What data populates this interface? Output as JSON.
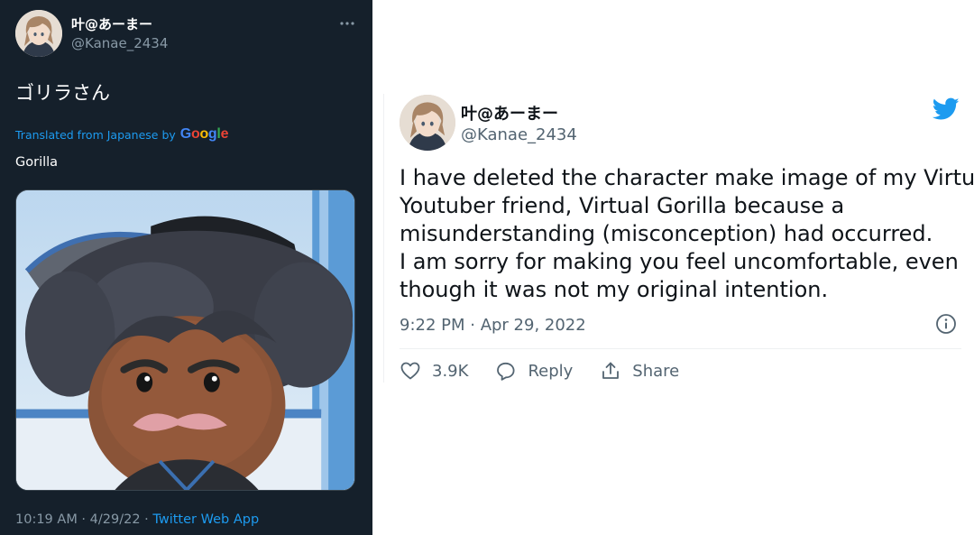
{
  "dark_tweet": {
    "display_name": "叶@あーまー",
    "handle": "@Kanae_2434",
    "more_icon": "more-horizontal-icon",
    "text": "ゴリラさん",
    "translated_label": "Translated from Japanese by",
    "google_letters": [
      "G",
      "o",
      "o",
      "g",
      "l",
      "e"
    ],
    "google_colors": [
      "#4285f4",
      "#ea4335",
      "#fbbc05",
      "#4285f4",
      "#34a853",
      "#ea4335"
    ],
    "translation": "Gorilla",
    "meta_time": "10:19 AM · 4/29/22 · ",
    "meta_source": "Twitter Web App",
    "colors": {
      "background": "#15202b",
      "accent": "#1d9bf0",
      "secondary_text": "#8899a6"
    }
  },
  "light_tweet": {
    "display_name": "叶@あーまー",
    "handle": "@Kanae_2434",
    "brand_icon": "twitter-bird-icon",
    "text_lines": [
      "I have deleted the character make image of my Virtual",
      "Youtuber friend, Virtual Gorilla because a",
      "misunderstanding (misconception) had occurred.",
      "I am sorry for making you feel uncomfortable, even",
      "though it was not my original intention."
    ],
    "timestamp": "9:22 PM · Apr 29, 2022",
    "info_icon": "info-icon",
    "actions": {
      "like_count": "3.9K",
      "reply_label": "Reply",
      "share_label": "Share"
    },
    "colors": {
      "brand": "#1d9bf0",
      "text": "#0f1419",
      "secondary_text": "#536471"
    }
  }
}
